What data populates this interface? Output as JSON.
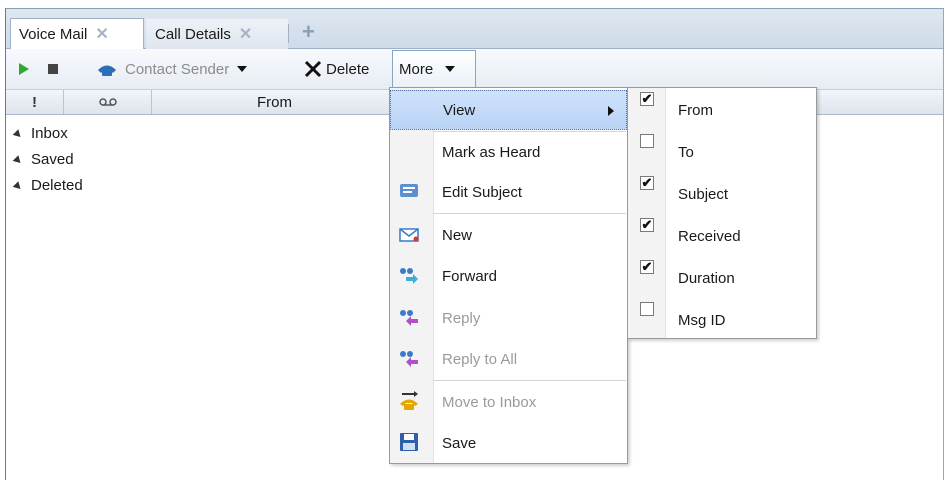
{
  "tabs": [
    {
      "label": "Voice Mail",
      "active": true
    },
    {
      "label": "Call Details",
      "active": false
    }
  ],
  "toolbar": {
    "contact_sender_label": "Contact Sender",
    "delete_label": "Delete",
    "more_label": "More"
  },
  "grid": {
    "columns": [
      "!",
      "From"
    ]
  },
  "tree": [
    "Inbox",
    "Saved",
    "Deleted"
  ],
  "more_menu": {
    "items": [
      {
        "label": "View",
        "icon": "none",
        "enabled": true,
        "has_submenu": true,
        "highlighted": true
      },
      {
        "label": "Mark as Heard",
        "icon": "none",
        "enabled": true
      },
      {
        "label": "Edit Subject",
        "icon": "edit-subject-icon",
        "enabled": true
      },
      {
        "label": "New",
        "icon": "new-message-icon",
        "enabled": true
      },
      {
        "label": "Forward",
        "icon": "forward-icon",
        "enabled": true
      },
      {
        "label": "Reply",
        "icon": "reply-icon",
        "enabled": false
      },
      {
        "label": "Reply to All",
        "icon": "reply-all-icon",
        "enabled": false
      },
      {
        "label": "Move to Inbox",
        "icon": "move-to-inbox-icon",
        "enabled": false
      },
      {
        "label": "Save",
        "icon": "save-icon",
        "enabled": true
      }
    ]
  },
  "view_submenu": {
    "items": [
      {
        "label": "From",
        "checked": true
      },
      {
        "label": "To",
        "checked": false
      },
      {
        "label": "Subject",
        "checked": true
      },
      {
        "label": "Received",
        "checked": true
      },
      {
        "label": "Duration",
        "checked": true
      },
      {
        "label": "Msg ID",
        "checked": false
      }
    ]
  },
  "colors": {
    "accent": "#b9d3f5",
    "play": "#2fa82f",
    "phone": "#2b6fb6"
  }
}
